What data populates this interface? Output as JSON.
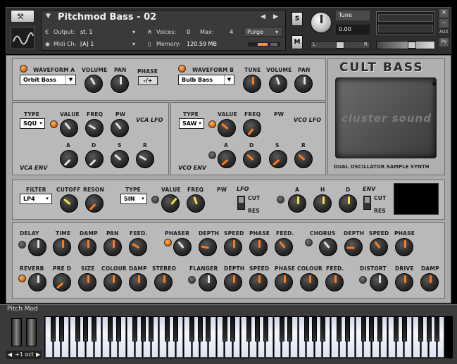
{
  "header": {
    "instrument_name": "Pitchmod Bass - 02",
    "output_label": "Output:",
    "output_value": "st. 1",
    "voices_label": "Voices:",
    "voices_value": "0",
    "max_label": "Max:",
    "max_value": "4",
    "purge_label": "Purge",
    "midi_label": "Midi Ch:",
    "midi_value": "[A]  1",
    "memory_label": "Memory:",
    "memory_value": "120.59 MB",
    "s_button": "S",
    "m_button": "M",
    "tune_label": "Tune",
    "tune_value": "0.00",
    "pan_l": "L",
    "pan_r": "R",
    "aux_label": "AUX",
    "pv_label": "PV"
  },
  "osc": {
    "waveform_a_label": "WAVEFORM A",
    "waveform_a_value": "Orbit Bass",
    "volume_label": "VOLUME",
    "pan_label": "PAN",
    "phase_label": "PHASE",
    "phase_button": "-/+",
    "waveform_b_label": "WAVEFORM B",
    "waveform_b_value": "Bulb Bass",
    "tune_label": "TUNE",
    "volume_b_label": "VOLUME",
    "pan_b_label": "PAN"
  },
  "brand": {
    "title": "CULT BASS",
    "logo_text": "cluster sound",
    "subtitle": "DUAL OSCILLATOR SAMPLE SYNTH"
  },
  "vca": {
    "type_label": "TYPE",
    "type_value": "SQU",
    "value_label": "VALUE",
    "freq_label": "FREQ",
    "pw_label": "PW",
    "lfo_title": "VCA LFO",
    "a": "A",
    "d": "D",
    "s": "S",
    "r": "R",
    "env_title": "VCA ENV"
  },
  "vco": {
    "type_label": "TYPE",
    "type_value": "SAW",
    "value_label": "VALUE",
    "freq_label": "FREQ",
    "pw_label": "PW",
    "lfo_title": "VCO LFO",
    "a": "A",
    "d": "D",
    "s": "S",
    "r": "R",
    "env_title": "VCO ENV"
  },
  "filter": {
    "filter_label": "FILTER",
    "filter_value": "LP4",
    "cutoff_label": "CUTOFF",
    "reson_label": "RESON",
    "type_label": "TYPE",
    "type_value": "SIN",
    "value_label": "VALUE",
    "freq_label": "FREQ",
    "pw_label": "PW",
    "lfo_title": "LFO",
    "lfo_cut": "CUT",
    "lfo_res": "RES",
    "a": "A",
    "h": "H",
    "d": "D",
    "env_title": "ENV",
    "env_cut": "CUT",
    "env_res": "RES"
  },
  "fx": {
    "delay": "DELAY",
    "time": "TIME",
    "damp": "DAMP",
    "pan": "PAN",
    "feed": "FEED.",
    "phaser": "PHASER",
    "depth": "DEPTH",
    "speed": "SPEED",
    "phase": "PHASE",
    "feed2": "FEED.",
    "chorus": "CHORUS",
    "depth2": "DEPTH",
    "speed2": "SPEED",
    "phase2": "PHASE",
    "reverb": "REVERB",
    "pre_d": "PRE D",
    "size": "SIZE",
    "colour": "COLOUR",
    "damp2": "DAMP",
    "stereo": "STEREO",
    "flanger": "FLANGER",
    "depth3": "DEPTH",
    "speed3": "SPEED",
    "phase3": "PHASE",
    "colour2": "COLOUR",
    "feed3": "FEED.",
    "distort": "DISTORT",
    "drive": "DRIVE",
    "damp3": "DAMP"
  },
  "keyboard": {
    "title": "Pitch Mod",
    "octave": "+1 oct"
  }
}
